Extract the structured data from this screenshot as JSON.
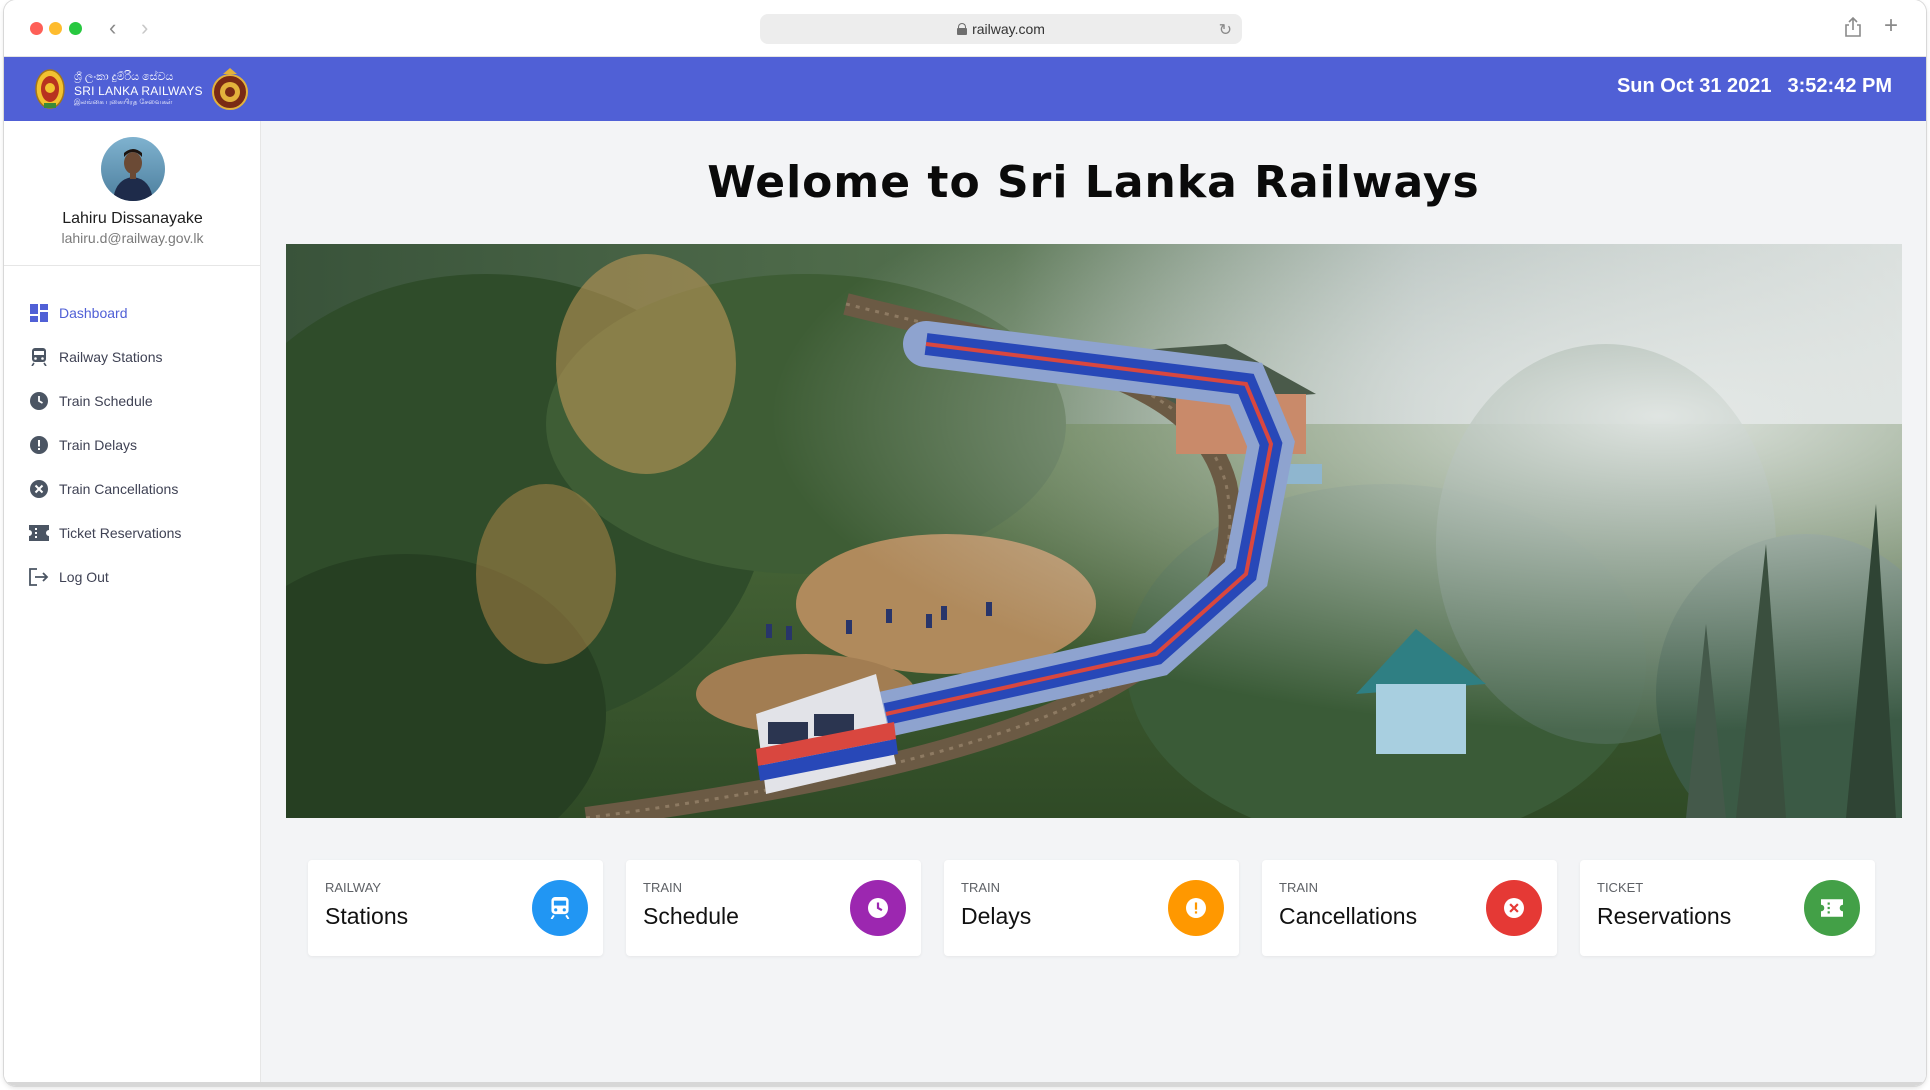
{
  "browser": {
    "url": "railway.com"
  },
  "header": {
    "logo_line1": "ශ්‍රී ලංකා දුම්රිය සේවය",
    "logo_line2": "SRI LANKA RAILWAYS",
    "logo_line3": "இலங்கை புகையிரத சேவைகள்",
    "date": "Sun Oct 31 2021",
    "time": "3:52:42 PM",
    "bar_color": "#5060d6"
  },
  "profile": {
    "name": "Lahiru Dissanayake",
    "email": "lahiru.d@railway.gov.lk"
  },
  "sidebar": {
    "items": [
      {
        "label": "Dashboard",
        "icon": "dashboard-icon",
        "active": true
      },
      {
        "label": "Railway Stations",
        "icon": "train-icon"
      },
      {
        "label": "Train Schedule",
        "icon": "clock-icon"
      },
      {
        "label": "Train Delays",
        "icon": "alert-icon"
      },
      {
        "label": "Train Cancellations",
        "icon": "cancel-icon"
      },
      {
        "label": "Ticket Reservations",
        "icon": "ticket-icon"
      },
      {
        "label": "Log Out",
        "icon": "logout-icon"
      }
    ]
  },
  "main": {
    "title": "Welome to Sri Lanka Railways",
    "hero_alt": "train-photo"
  },
  "cards": [
    {
      "small": "RAILWAY",
      "big": "Stations",
      "icon": "train-icon",
      "color": "#2196f3"
    },
    {
      "small": "TRAIN",
      "big": "Schedule",
      "icon": "clock-icon",
      "color": "#9c27b0"
    },
    {
      "small": "TRAIN",
      "big": "Delays",
      "icon": "alert-icon",
      "color": "#ff9800"
    },
    {
      "small": "TRAIN",
      "big": "Cancellations",
      "icon": "cancel-icon",
      "color": "#e53935"
    },
    {
      "small": "TICKET",
      "big": "Reservations",
      "icon": "ticket-icon",
      "color": "#43a047"
    }
  ]
}
